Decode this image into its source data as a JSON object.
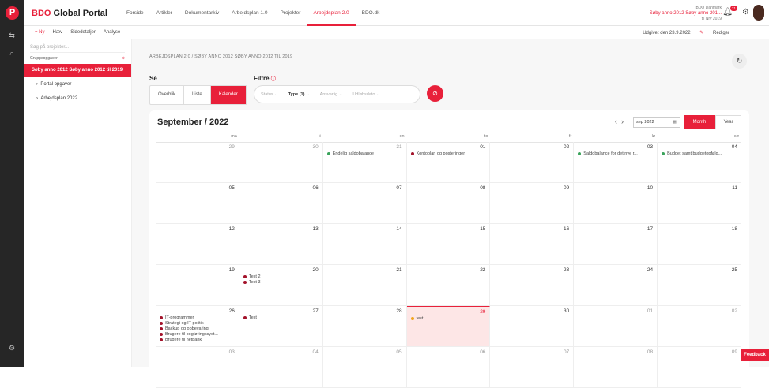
{
  "app": {
    "brand_prefix": "BDO",
    "brand_name": " Global Portal"
  },
  "nav": [
    "Forside",
    "Artikler",
    "Dokumentarkiv",
    "Arbejdsplan 1.0",
    "Projekter",
    "Arbejdsplan 2.0",
    "BDO.dk"
  ],
  "nav_active": 5,
  "user": {
    "line1": "BDO Danmark",
    "name": "Søby anno 2012 Søby anno 201...",
    "line3": "til Nrv 2019",
    "badge": "21"
  },
  "toolbar": {
    "new": "+ Ny",
    "haev": "Hæv",
    "sidedetaljer": "Sidedetaljer",
    "analyse": "Analyse",
    "published": "Udgivet den 23.9.2022",
    "edit": "Rediger"
  },
  "sidebar": {
    "search_placeholder": "Søg på projekter...",
    "group_header": "Gruppeopgaver",
    "selected": "Søby anno 2012 Søby anno 2012 til 2019",
    "items": [
      "Portal opgaver",
      "Arbejdsplan 2022"
    ]
  },
  "breadcrumb": "ARBEJDSPLAN 2.0 / SØBY ANNO 2012 SØBY ANNO 2012 TIL 2019",
  "view": {
    "label": "Se",
    "tabs": [
      "Overblik",
      "Liste",
      "Kalender"
    ],
    "active": 2
  },
  "filters": {
    "label": "Filtre",
    "items": [
      "Status",
      "Type (1)",
      "Ansvarlig",
      "Udløbsdato"
    ]
  },
  "calendar": {
    "title": "September / 2022",
    "date_value": "sep 2022",
    "month_btn": "Month",
    "year_btn": "Year",
    "dows": [
      "ma",
      "ti",
      "on",
      "to",
      "fr",
      "lø",
      "sø"
    ],
    "cells": [
      {
        "d": "29",
        "o": true,
        "ev": []
      },
      {
        "d": "30",
        "o": true,
        "ev": []
      },
      {
        "d": "31",
        "o": true,
        "ev": [
          {
            "t": "Endelig saldobalance",
            "c": "#3aa35b"
          }
        ]
      },
      {
        "d": "01",
        "ev": [
          {
            "t": "Kontoplan og posteringer",
            "c": "#a3122a"
          }
        ]
      },
      {
        "d": "02",
        "ev": []
      },
      {
        "d": "03",
        "ev": [
          {
            "t": "Saldobalance for det nye r...",
            "c": "#3aa35b"
          }
        ]
      },
      {
        "d": "04",
        "ev": [
          {
            "t": "Budget samt budgetopfølg...",
            "c": "#3aa35b"
          }
        ]
      },
      {
        "d": "05",
        "ev": []
      },
      {
        "d": "06",
        "ev": []
      },
      {
        "d": "07",
        "ev": []
      },
      {
        "d": "08",
        "ev": []
      },
      {
        "d": "09",
        "ev": []
      },
      {
        "d": "10",
        "ev": []
      },
      {
        "d": "11",
        "ev": []
      },
      {
        "d": "12",
        "ev": []
      },
      {
        "d": "13",
        "ev": []
      },
      {
        "d": "14",
        "ev": []
      },
      {
        "d": "15",
        "ev": []
      },
      {
        "d": "16",
        "ev": []
      },
      {
        "d": "17",
        "ev": []
      },
      {
        "d": "18",
        "ev": []
      },
      {
        "d": "19",
        "ev": []
      },
      {
        "d": "20",
        "ev": [
          {
            "t": "Test 2",
            "c": "#a3122a"
          },
          {
            "t": "Test 3",
            "c": "#a3122a"
          }
        ]
      },
      {
        "d": "21",
        "ev": []
      },
      {
        "d": "22",
        "ev": []
      },
      {
        "d": "23",
        "ev": []
      },
      {
        "d": "24",
        "ev": []
      },
      {
        "d": "25",
        "ev": []
      },
      {
        "d": "26",
        "ev": [
          {
            "t": "IT-programmer",
            "c": "#a3122a"
          },
          {
            "t": "Strategi og IT-politik",
            "c": "#a3122a"
          },
          {
            "t": "Backup og opbevaring",
            "c": "#a3122a"
          },
          {
            "t": "Brugere til bogføringssyst...",
            "c": "#a3122a"
          },
          {
            "t": "Brugere til netbank",
            "c": "#a3122a"
          }
        ]
      },
      {
        "d": "27",
        "ev": [
          {
            "t": "Test",
            "c": "#a3122a"
          }
        ]
      },
      {
        "d": "28",
        "ev": []
      },
      {
        "d": "29",
        "today": true,
        "ev": [
          {
            "t": "test",
            "c": "#f2a41c"
          }
        ]
      },
      {
        "d": "30",
        "ev": []
      },
      {
        "d": "01",
        "o": true,
        "ev": []
      },
      {
        "d": "02",
        "o": true,
        "ev": []
      },
      {
        "d": "03",
        "o": true,
        "ev": []
      },
      {
        "d": "04",
        "o": true,
        "ev": []
      },
      {
        "d": "05",
        "o": true,
        "ev": []
      },
      {
        "d": "06",
        "o": true,
        "ev": []
      },
      {
        "d": "07",
        "o": true,
        "ev": []
      },
      {
        "d": "08",
        "o": true,
        "ev": []
      },
      {
        "d": "09",
        "o": true,
        "ev": []
      }
    ]
  },
  "feedback": "Feedback",
  "colors": {
    "accent": "#e8203a",
    "rail": "#262626"
  }
}
